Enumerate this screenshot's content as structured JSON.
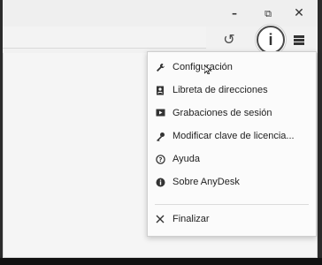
{
  "titlebar": {
    "buttons": {
      "minimize": "–",
      "maximize": "⧉",
      "close": "✕"
    }
  },
  "toolbar": {
    "history_icon": "↺",
    "info_label": "i"
  },
  "menu": {
    "items": [
      {
        "icon": "wrench-icon",
        "label": "Configuración"
      },
      {
        "icon": "address-book-icon",
        "label": "Libreta de direcciones"
      },
      {
        "icon": "recording-icon",
        "label": "Grabaciones de sesión"
      },
      {
        "icon": "key-icon",
        "label": "Modificar clave de licencia..."
      },
      {
        "icon": "help-icon",
        "label": "Ayuda"
      },
      {
        "icon": "info-icon",
        "label": "Sobre AnyDesk"
      },
      {
        "icon": "close-icon",
        "label": "Finalizar"
      }
    ]
  },
  "colors": {
    "arrow_green": "#39c12d"
  }
}
